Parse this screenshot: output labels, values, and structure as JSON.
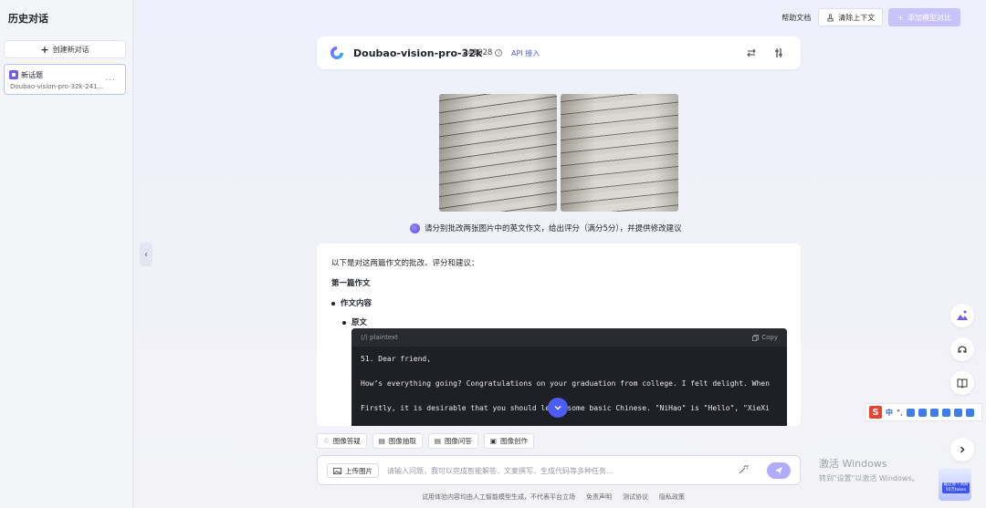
{
  "sidebar": {
    "title": "历史对话",
    "new_chat_label": "创建新对话",
    "conversations": [
      {
        "title": "新话题",
        "subtitle": "Doubao-vision-pro-32k-241...",
        "more": "..."
      }
    ]
  },
  "header": {
    "docs_link": "帮助文档",
    "clear_context_label": "清除上下文",
    "add_compare_label": "添加模型对比"
  },
  "model": {
    "name": "Doubao-vision-pro-32k",
    "version": "241028",
    "api_label": "API 接入"
  },
  "chat": {
    "user_prompt": "请分别批改两张图片中的英文作文，给出评分（满分5分），并提供修改建议",
    "answer": {
      "intro": "以下是对这两篇作文的批改、评分和建议：",
      "heading": "第一篇作文",
      "bullet1": "作文内容",
      "bullet2": "原文",
      "code": {
        "language": "plaintext",
        "copy_label": "Copy",
        "lines": [
          "51. Dear friend,",
          "How’s everything going? Congratulations on your graduation from college. I felt delight. When",
          "Firstly, it is desirable that you should learn some basic Chinese. \"NiHao\" is \"Hello\", \"XieXi"
        ]
      }
    }
  },
  "chips": [
    "图像答疑",
    "图像抽取",
    "图像问答",
    "图像创作"
  ],
  "input": {
    "upload_label": "上传图片",
    "placeholder": "请输入问题，我可以完成智能解答、文案撰写、生成代码等多种任务..."
  },
  "footer": {
    "links": [
      "试用体验内容均由人工智能模型生成，不代表平台立场",
      "免责声明",
      "测试协议",
      "隐私政策"
    ]
  },
  "ime": {
    "logo": "S",
    "mode": "中",
    "punct": "°,"
  },
  "windows_watermark": {
    "title": "激活 Windows",
    "subtitle": "转到\"设置\"以激活 Windows。"
  },
  "pet_tag": "最近你个项目 50万token",
  "colors": {
    "accent": "#4d5cf6",
    "accent_light": "#c9c2fb",
    "code_bg": "#1f2025"
  }
}
